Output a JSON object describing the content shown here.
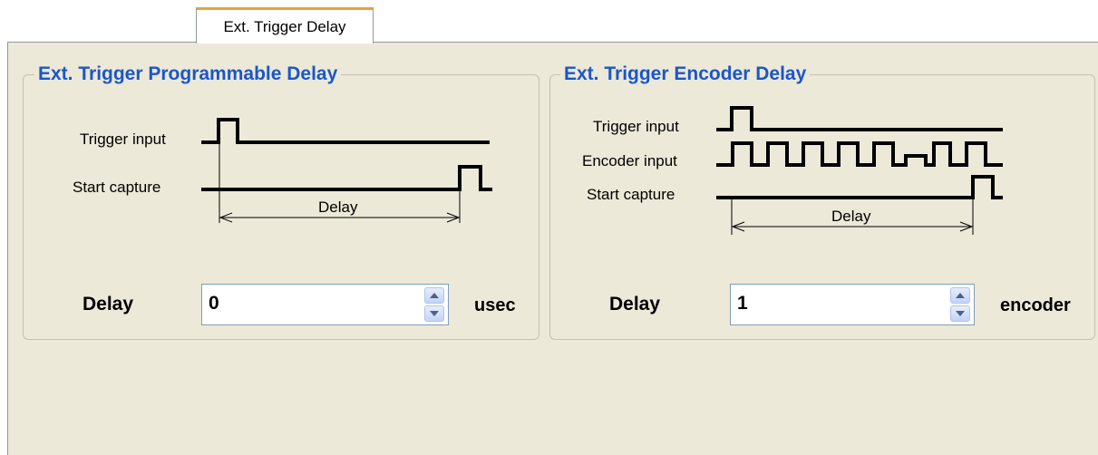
{
  "tab": {
    "label": "Ext. Trigger Delay"
  },
  "programmable": {
    "title": "Ext. Trigger Programmable Delay",
    "diagram": {
      "trigger_input": "Trigger input",
      "start_capture": "Start capture",
      "delay": "Delay"
    },
    "delay_label": "Delay",
    "delay_value": "0",
    "unit": "usec"
  },
  "encoder": {
    "title": "Ext. Trigger Encoder Delay",
    "diagram": {
      "trigger_input": "Trigger input",
      "encoder_input": "Encoder input",
      "start_capture": "Start capture",
      "delay": "Delay"
    },
    "delay_label": "Delay",
    "delay_value": "1",
    "unit": "encoder"
  },
  "icons": [
    "spin-up-icon",
    "spin-down-icon"
  ]
}
